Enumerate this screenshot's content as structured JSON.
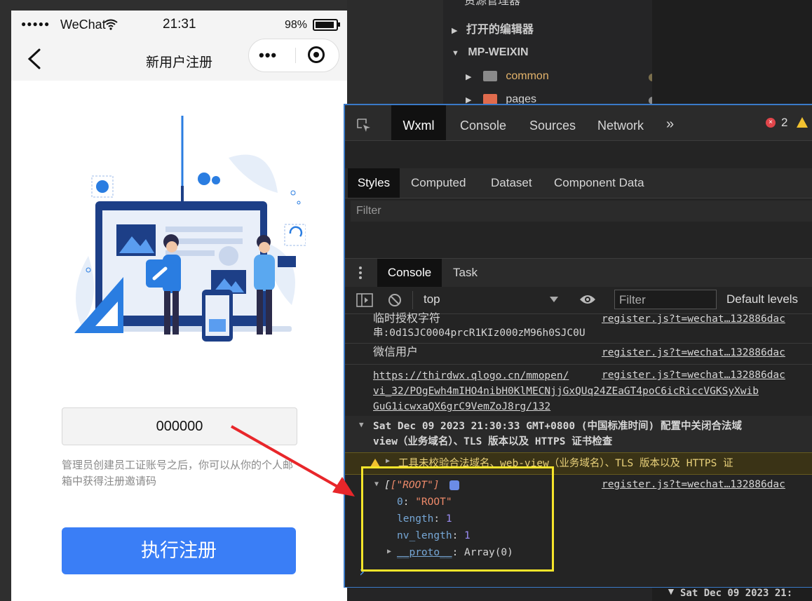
{
  "phone": {
    "status": {
      "carrier": "WeChat",
      "signal": "●●●●●",
      "time": "21:31",
      "battery": "98%"
    },
    "nav": {
      "title": "新用户注册",
      "capsule_dots": "•••"
    },
    "form": {
      "invite_code_value": "000000",
      "hint": "管理员创建员工证账号之后，你可以从你的个人邮箱中获得注册邀请码",
      "submit_label": "执行注册"
    }
  },
  "explorer": {
    "header": "资源管理器",
    "open_editors": "打开的编辑器",
    "project": "MP-WEIXIN",
    "items": [
      {
        "label": "common",
        "color": "#8a8a8a"
      },
      {
        "label": "pages",
        "color": "#e06b4d"
      }
    ]
  },
  "devtools": {
    "tabs": [
      "Wxml",
      "Console",
      "Sources",
      "Network",
      "»"
    ],
    "error_count": "2",
    "subtabs": [
      "Styles",
      "Computed",
      "Dataset",
      "Component Data"
    ],
    "styles_filter": "Filter",
    "drawer_tabs": [
      "Console",
      "Task"
    ],
    "toolbar": {
      "context": "top",
      "filter_placeholder": "Filter",
      "levels": "Default levels"
    },
    "messages": {
      "m1_line1": "临时授权字符",
      "m1_line2": "串:0d1SJC0004prcR1KIz000zM96h0SJC0U",
      "m1_src": "register.js?t=wechat…132886dac",
      "m2_text": "微信用户",
      "m2_src": "register.js?t=wechat…132886dac",
      "m3_line1": "https://thirdwx.qlogo.cn/mmopen/",
      "m3_line2": "vi_32/POgEwh4mIHO4nibH0KlMECNjjGxQUq24ZEaGT4poC6icRiccVGKSyXwib",
      "m3_line3": "GuG1icwxaQX6grC9VemZoJ8rg/132",
      "m3_src": "register.js?t=wechat…132886dac",
      "group_line1": "Sat Dec 09 2023 21:30:33 GMT+0800 (中国标准时间) 配置中关闭合法域",
      "group_line2": "view（业务域名）、TLS 版本以及 HTTPS 证书检查",
      "warn_text": "工具未校验合法域名、web-view（业务域名）、TLS 版本以及 HTTPS 证",
      "array_label": "[\"ROOT\"]",
      "array_src": "register.js?t=wechat…132886dac",
      "prop0_key": "0",
      "prop0_val": "\"ROOT\"",
      "prop1_key": "length",
      "prop1_val": "1",
      "prop2_key": "nv_length",
      "prop2_val": "1",
      "proto_key": "__proto__",
      "proto_val": "Array(0)",
      "prompt": "›"
    }
  },
  "background_bottom": "Sat Dec 09 2023 21:",
  "colors": {
    "primary_button": "#3a7ef6",
    "annotation_box": "#f6e52a",
    "annotation_arrow": "#e8262a",
    "devtools_border": "#3a7ac8"
  }
}
